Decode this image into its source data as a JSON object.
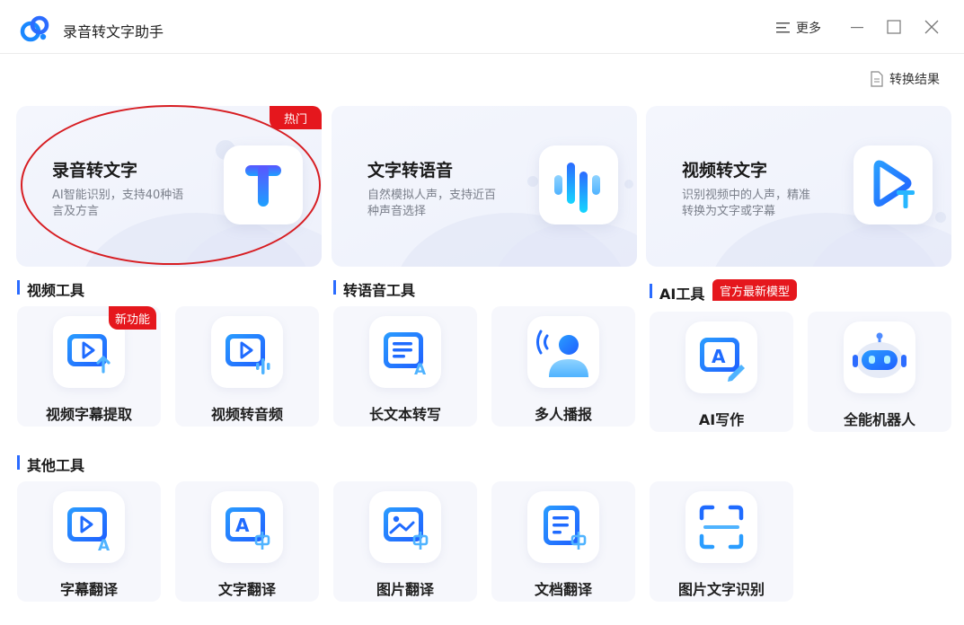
{
  "window": {
    "title": "录音转文字助手"
  },
  "header": {
    "more_label": "更多"
  },
  "toolbar": {
    "result_label": "转换结果"
  },
  "hero_cards": [
    {
      "title": "录音转文字",
      "desc": "AI智能识别，支持40种语言及方言",
      "badge": "热门",
      "icon": "text-t-icon"
    },
    {
      "title": "文字转语音",
      "desc": "自然模拟人声，支持近百种声音选择",
      "icon": "sound-wave-icon"
    },
    {
      "title": "视频转文字",
      "desc": "识别视频中的人声，精准转换为文字或字幕",
      "icon": "video-to-text-icon"
    }
  ],
  "sections": {
    "video_tools": "视频工具",
    "voice_tools": "转语音工具",
    "ai_tools": "AI工具",
    "ai_badge": "官方最新模型",
    "other_tools": "其他工具"
  },
  "tools": {
    "video": [
      {
        "label": "视频字幕提取",
        "badge": "新功能",
        "icon": "video-subtitle-extract-icon"
      },
      {
        "label": "视频转音频",
        "icon": "video-to-audio-icon"
      }
    ],
    "voice": [
      {
        "label": "长文本转写",
        "icon": "long-text-icon"
      },
      {
        "label": "多人播报",
        "icon": "multi-speaker-icon"
      }
    ],
    "ai": [
      {
        "label": "AI写作",
        "icon": "ai-writing-icon"
      },
      {
        "label": "全能机器人",
        "icon": "robot-icon"
      }
    ],
    "other": [
      {
        "label": "字幕翻译",
        "icon": "subtitle-translate-icon"
      },
      {
        "label": "文字翻译",
        "icon": "text-translate-icon"
      },
      {
        "label": "图片翻译",
        "icon": "image-translate-icon"
      },
      {
        "label": "文档翻译",
        "icon": "document-translate-icon"
      },
      {
        "label": "图片文字识别",
        "icon": "ocr-scan-icon"
      }
    ]
  },
  "colors": {
    "accent": "#2a6bff",
    "badge_red": "#e5171d",
    "tile_bg": "#f6f7fc",
    "annotation": "#d71d22"
  }
}
